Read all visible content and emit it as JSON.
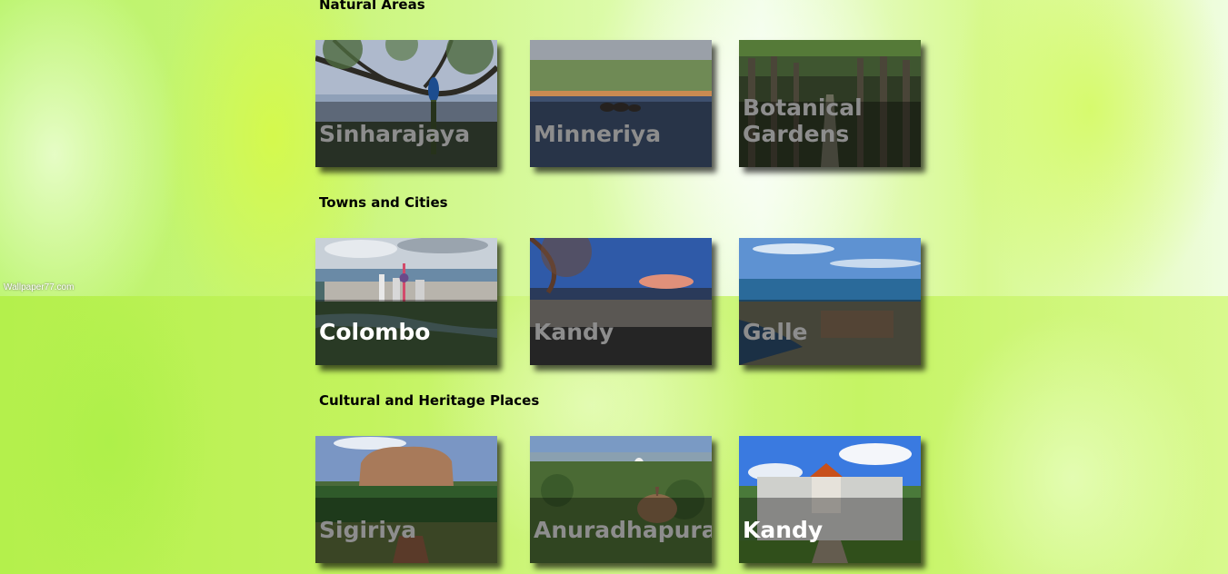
{
  "watermark": "Wallpaper77.com",
  "sections": [
    {
      "title": "Natural Areas",
      "cards": [
        {
          "label": "Sinharajaya",
          "image": "peacock-on-branch",
          "active": false
        },
        {
          "label": "Minneriya",
          "image": "elephants-at-lake",
          "active": false
        },
        {
          "label": "Botanical Gardens",
          "image": "palm-avenue",
          "active": false
        }
      ]
    },
    {
      "title": "Towns and Cities",
      "cards": [
        {
          "label": "Colombo",
          "image": "colombo-skyline",
          "active": true
        },
        {
          "label": "Kandy",
          "image": "kandy-lake-wall",
          "active": false
        },
        {
          "label": "Galle",
          "image": "galle-fort-coast",
          "active": false
        }
      ]
    },
    {
      "title": "Cultural and Heritage Places",
      "cards": [
        {
          "label": "Sigiriya",
          "image": "sigiriya-rock",
          "active": false
        },
        {
          "label": "Anuradhapura",
          "image": "stupa-in-forest",
          "active": false
        },
        {
          "label": "Kandy",
          "image": "temple-of-the-tooth",
          "active": true
        }
      ]
    }
  ]
}
